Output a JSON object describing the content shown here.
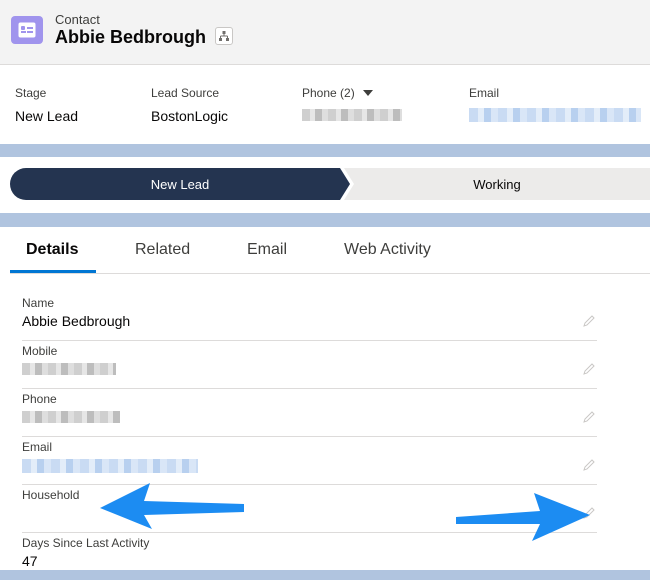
{
  "header": {
    "object_type": "Contact",
    "record_name": "Abbie Bedbrough",
    "icon": "contact-card-icon",
    "hierarchy_icon": "hierarchy-icon"
  },
  "highlights": [
    {
      "label": "Stage",
      "value": "New Lead"
    },
    {
      "label": "Lead Source",
      "value": "BostonLogic"
    },
    {
      "label": "Phone (2)",
      "value": ""
    },
    {
      "label": "Email",
      "value": ""
    }
  ],
  "path": {
    "current_stage": "New Lead",
    "next_stage": "Working",
    "colors": {
      "current": "#243450",
      "next": "#ecebea"
    }
  },
  "tabs": [
    "Details",
    "Related",
    "Email",
    "Web Activity"
  ],
  "active_tab": "Details",
  "fields": [
    {
      "label": "Name",
      "value": "Abbie Bedbrough"
    },
    {
      "label": "Mobile",
      "value": ""
    },
    {
      "label": "Phone",
      "value": ""
    },
    {
      "label": "Email",
      "value": ""
    },
    {
      "label": "Household",
      "value": ""
    },
    {
      "label": "Days Since Last Activity",
      "value": "47"
    }
  ],
  "annotations": {
    "arrow_color": "#1c8cf2",
    "arrow_icon": "blue-pointer-arrow"
  }
}
